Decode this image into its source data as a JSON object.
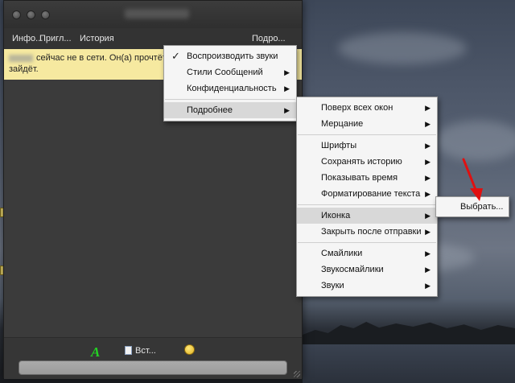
{
  "window": {
    "toolbar": {
      "info": "Инфо...",
      "invite": "Пригл...",
      "history": "История",
      "more": "Подро..."
    },
    "notice": {
      "text_line1": "сейчас не в сети. Он(а) прочтёт",
      "text_line2": "зайдёт."
    },
    "bottom": {
      "font_glyph": "A",
      "insert_label": "Вст..."
    }
  },
  "menu_main": {
    "items": [
      {
        "label": "Воспроизводить звуки",
        "checked": true
      },
      {
        "label": "Стили Сообщений"
      },
      {
        "label": "Конфиденциальность"
      },
      {
        "label": "Подробнее"
      }
    ]
  },
  "menu_more": {
    "items": [
      {
        "label": "Поверх всех окон"
      },
      {
        "label": "Мерцание"
      },
      {
        "label": "Шрифты"
      },
      {
        "label": "Сохранять историю"
      },
      {
        "label": "Показывать время"
      },
      {
        "label": "Форматирование текста"
      },
      {
        "label": "Иконка"
      },
      {
        "label": "Закрыть после отправки"
      },
      {
        "label": "Смайлики"
      },
      {
        "label": "Звукосмайлики"
      },
      {
        "label": "Звуки"
      }
    ]
  },
  "menu_icon": {
    "items": [
      {
        "label": "Выбрать..."
      }
    ]
  },
  "glyphs": {
    "check": "✓",
    "submenu_arrow": "▶"
  },
  "colors": {
    "notice_bg": "#f6e9a0",
    "window_bg": "#3a3a3a",
    "menu_bg": "#f5f5f5",
    "menu_highlight": "#d8d8d8",
    "font_icon": "#23d423",
    "annotation_arrow": "#e01010"
  }
}
